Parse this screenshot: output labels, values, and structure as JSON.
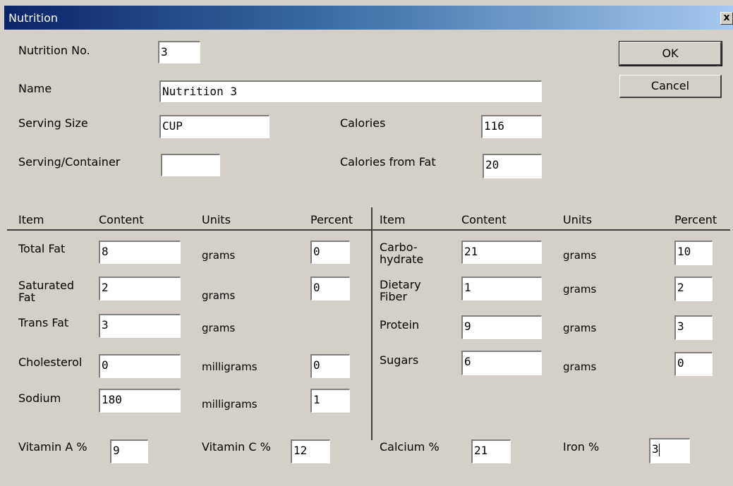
{
  "window": {
    "title": "Nutrition",
    "close_label": "x"
  },
  "buttons": {
    "ok": "OK",
    "cancel": "Cancel"
  },
  "top": {
    "nutrition_no_label": "Nutrition No.",
    "nutrition_no_value": "3",
    "name_label": "Name",
    "name_value": "Nutrition 3",
    "serving_size_label": "Serving Size",
    "serving_size_value": "CUP",
    "serving_container_label": "Serving/Container",
    "serving_container_value": "",
    "calories_label": "Calories",
    "calories_value": "116",
    "calories_fat_label": "Calories from Fat",
    "calories_fat_value": "20"
  },
  "headers": {
    "item": "Item",
    "content": "Content",
    "units": "Units",
    "percent": "Percent"
  },
  "left_rows": [
    {
      "item": "Total Fat",
      "content": "8",
      "units": "grams",
      "percent": "0"
    },
    {
      "item": "Saturated\nFat",
      "content": "2",
      "units": "grams",
      "percent": "0"
    },
    {
      "item": "Trans Fat",
      "content": "3",
      "units": "grams"
    },
    {
      "item": "Cholesterol",
      "content": "0",
      "units": "milligrams",
      "percent": "0"
    },
    {
      "item": "Sodium",
      "content": "180",
      "units": "milligrams",
      "percent": "1"
    }
  ],
  "right_rows": [
    {
      "item": "Carbo-\nhydrate",
      "content": "21",
      "units": "grams",
      "percent": "10"
    },
    {
      "item": "Dietary\nFiber",
      "content": "1",
      "units": "grams",
      "percent": "2"
    },
    {
      "item": "Protein",
      "content": "9",
      "units": "grams",
      "percent": "3"
    },
    {
      "item": "Sugars",
      "content": "6",
      "units": "grams",
      "percent": "0"
    }
  ],
  "vitamins": {
    "vitamin_a_label": "Vitamin A %",
    "vitamin_a_value": "9",
    "vitamin_c_label": "Vitamin C %",
    "vitamin_c_value": "12",
    "calcium_label": "Calcium %",
    "calcium_value": "21",
    "iron_label": "Iron %",
    "iron_value": "3"
  }
}
